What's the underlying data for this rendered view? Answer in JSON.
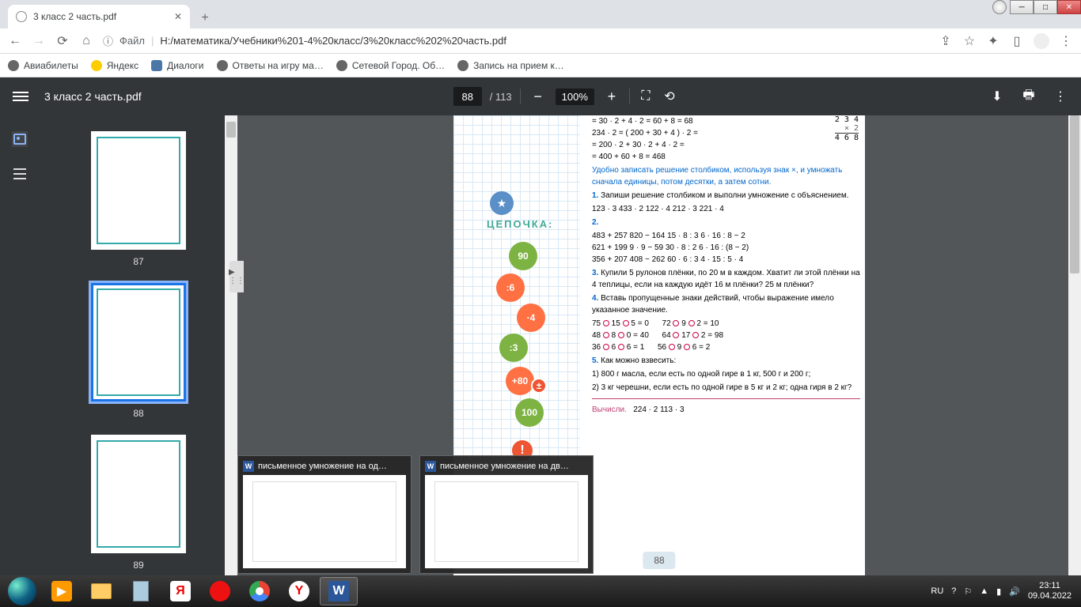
{
  "window": {
    "title": "3 класс 2 часть.pdf"
  },
  "tab": {
    "title": "3 класс 2 часть.pdf"
  },
  "url": {
    "file_label": "Файл",
    "path": "H:/математика/Учебники%201-4%20класс/3%20класс%202%20часть.pdf"
  },
  "bookmarks": [
    {
      "label": "Авиабилеты",
      "icon": "globe"
    },
    {
      "label": "Яндекс",
      "icon": "yandex"
    },
    {
      "label": "Диалоги",
      "icon": "vk"
    },
    {
      "label": "Ответы на игру ма…",
      "icon": "globe"
    },
    {
      "label": "Сетевой Город. Об…",
      "icon": "globe"
    },
    {
      "label": "Запись на прием к…",
      "icon": "globe"
    }
  ],
  "pdf": {
    "title": "3 класс 2 часть.pdf",
    "page_current": "88",
    "page_total": "/ 113",
    "zoom": "100%",
    "thumbs": [
      {
        "num": "87",
        "selected": false
      },
      {
        "num": "88",
        "selected": true
      },
      {
        "num": "89",
        "selected": false
      }
    ]
  },
  "page_content": {
    "chain_label": "ЦЕПОЧКА:",
    "gears": [
      "90",
      ":6",
      "·4",
      ":3",
      "+80",
      "100"
    ],
    "mult_table": {
      "top": "  2 3 4",
      "mid": "×     2",
      "bottom": "  4 6 8"
    },
    "eq_lines": [
      "= 30 · 2 + 4 · 2 = 60 + 8 = 68",
      "234 · 2 = ( 200 + 30 + 4 ) · 2 =",
      "= 200 · 2 + 30 · 2 + 4 · 2 =",
      "= 400 + 60 + 8 = 468"
    ],
    "explain": "Удобно записать решение столбиком, используя знак ×, и умножать сначала единицы, потом десятки, а затем сотни.",
    "task1": {
      "num": "1.",
      "text": "Запиши решение столбиком и выполни умножение с объяснением.",
      "row": "123 · 3      433 · 2      122 · 4      212 · 3      221 · 4"
    },
    "task2": {
      "num": "2.",
      "rows": [
        "483 + 257      820 − 164      15 · 8 : 3      6 · 16 : 8 − 2",
        "621 + 199      9 · 9 − 59       30 · 8 : 2      6 · 16 : (8 − 2)",
        "356 + 207      408 − 262      60 · 6 : 3      4 · 15 : 5 · 4"
      ]
    },
    "task3": {
      "num": "3.",
      "text": "Купили 5 рулонов плёнки, по 20 м в каждом. Хватит ли этой плёнки на 4 теплицы, если на каждую идёт 16 м плёнки? 25 м плёнки?"
    },
    "task4": {
      "num": "4.",
      "text": "Вставь пропущенные знаки действий, чтобы выражение имело указанное значение.",
      "rows": [
        [
          "75",
          "15",
          "5 = 0",
          "72",
          "9",
          "2 = 10"
        ],
        [
          "48",
          "8",
          "0 = 40",
          "64",
          "17",
          "2 = 98"
        ],
        [
          "36",
          "6",
          "6 = 1",
          "56",
          "9",
          "6 = 2"
        ]
      ]
    },
    "task5": {
      "num": "5.",
      "text": "Как можно взвесить:",
      "sub1": "1) 800 г масла, если есть по одной гире в 1 кг, 500 г и 200 г;",
      "sub2": "2) 3 кг черешни, если есть по одной гире в 5 кг и 2 кг; одна гиря в 2 кг?"
    },
    "footer": {
      "label": "Вычисли.",
      "exprs": "224 · 2        113 · 3"
    },
    "page_num": "88"
  },
  "task_previews": [
    {
      "title": "письменное умножение на од…"
    },
    {
      "title": "письменное умножение на дв…"
    }
  ],
  "tray": {
    "lang": "RU",
    "time": "23:11",
    "date": "09.04.2022"
  }
}
